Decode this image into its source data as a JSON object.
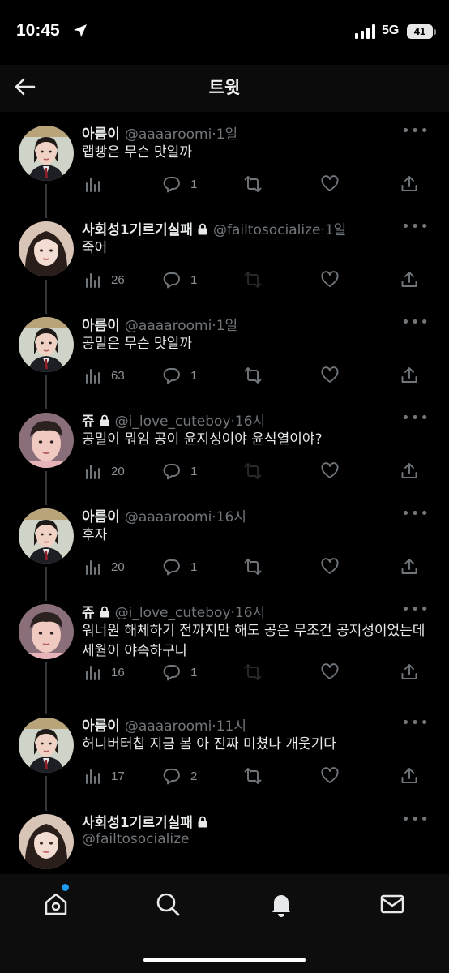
{
  "status_bar": {
    "time": "10:45",
    "network": "5G",
    "battery": "41"
  },
  "header": {
    "title": "트윗",
    "back_icon": "arrow-left-icon"
  },
  "colors": {
    "accent": "#1d9bf0",
    "muted": "#71767b",
    "text": "#e7e9ea",
    "background": "#000000"
  },
  "tweets": [
    {
      "name": "아름이",
      "locked": false,
      "handle": "@aaaaroomi",
      "dot": "·",
      "time": "1일",
      "text": "랩빵은 무슨 맛일까",
      "views": "",
      "replies": "1",
      "retweet_disabled": false,
      "avatar": "boy-uniform"
    },
    {
      "name": "사회성1기르기실패",
      "locked": true,
      "handle": "@failtosocialize",
      "dot": "·",
      "time": "1일",
      "text": "죽어",
      "views": "26",
      "replies": "1",
      "retweet_disabled": true,
      "avatar": "girl"
    },
    {
      "name": "아름이",
      "locked": false,
      "handle": "@aaaaroomi",
      "dot": "·",
      "time": "1일",
      "text": "공밀은 무슨 맛일까",
      "views": "63",
      "replies": "1",
      "retweet_disabled": false,
      "avatar": "boy-uniform"
    },
    {
      "name": "쥬",
      "locked": true,
      "handle": "@i_love_cuteboy",
      "dot": "·",
      "time": "16시",
      "text": "공밀이 뭐임 공이 윤지성이야 윤석열이야?",
      "views": "20",
      "replies": "1",
      "retweet_disabled": true,
      "avatar": "boy-casual"
    },
    {
      "name": "아름이",
      "locked": false,
      "handle": "@aaaaroomi",
      "dot": "·",
      "time": "16시",
      "text": "후자",
      "views": "20",
      "replies": "1",
      "retweet_disabled": false,
      "avatar": "boy-uniform"
    },
    {
      "name": "쥬",
      "locked": true,
      "handle": "@i_love_cuteboy",
      "dot": "·",
      "time": "16시",
      "text": "워너원 해체하기 전까지만 해도 공은 무조건 공지성이었는데 세월이 야속하구나",
      "views": "16",
      "replies": "1",
      "retweet_disabled": true,
      "avatar": "boy-casual"
    },
    {
      "name": "아름이",
      "locked": false,
      "handle": "@aaaaroomi",
      "dot": "·",
      "time": "11시",
      "text": "허니버터칩 지금 봄 아 진짜 미쳤나 개웃기다",
      "views": "17",
      "replies": "2",
      "retweet_disabled": false,
      "avatar": "boy-uniform"
    }
  ],
  "last_tweet": {
    "name": "사회성1기르기실패",
    "locked": true,
    "handle": "@failtosocialize",
    "avatar": "girl"
  },
  "bottom_nav": [
    {
      "icon": "home-icon",
      "has_badge": true
    },
    {
      "icon": "search-icon"
    },
    {
      "icon": "bell-icon"
    },
    {
      "icon": "envelope-icon"
    }
  ]
}
